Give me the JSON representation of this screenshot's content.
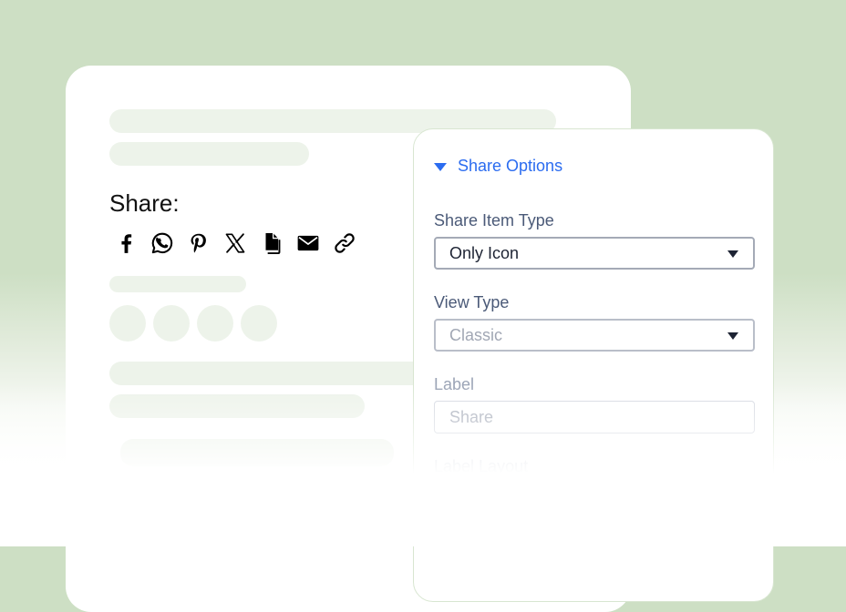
{
  "preview": {
    "share_heading": "Share:",
    "share_icons": [
      "facebook-icon",
      "whatsapp-icon",
      "pinterest-icon",
      "x-icon",
      "copy-icon",
      "email-icon",
      "link-icon"
    ]
  },
  "settings": {
    "section_title": "Share Options",
    "share_item_type": {
      "label": "Share Item Type",
      "value": "Only Icon"
    },
    "view_type": {
      "label": "View Type",
      "value": "Classic"
    },
    "label_field": {
      "label": "Label",
      "placeholder": "Share"
    },
    "label_layout": {
      "label": "Label Layout"
    }
  },
  "colors": {
    "accent": "#2b6cf0",
    "background": "#cddfc4",
    "skeleton": "#edf3ea"
  }
}
